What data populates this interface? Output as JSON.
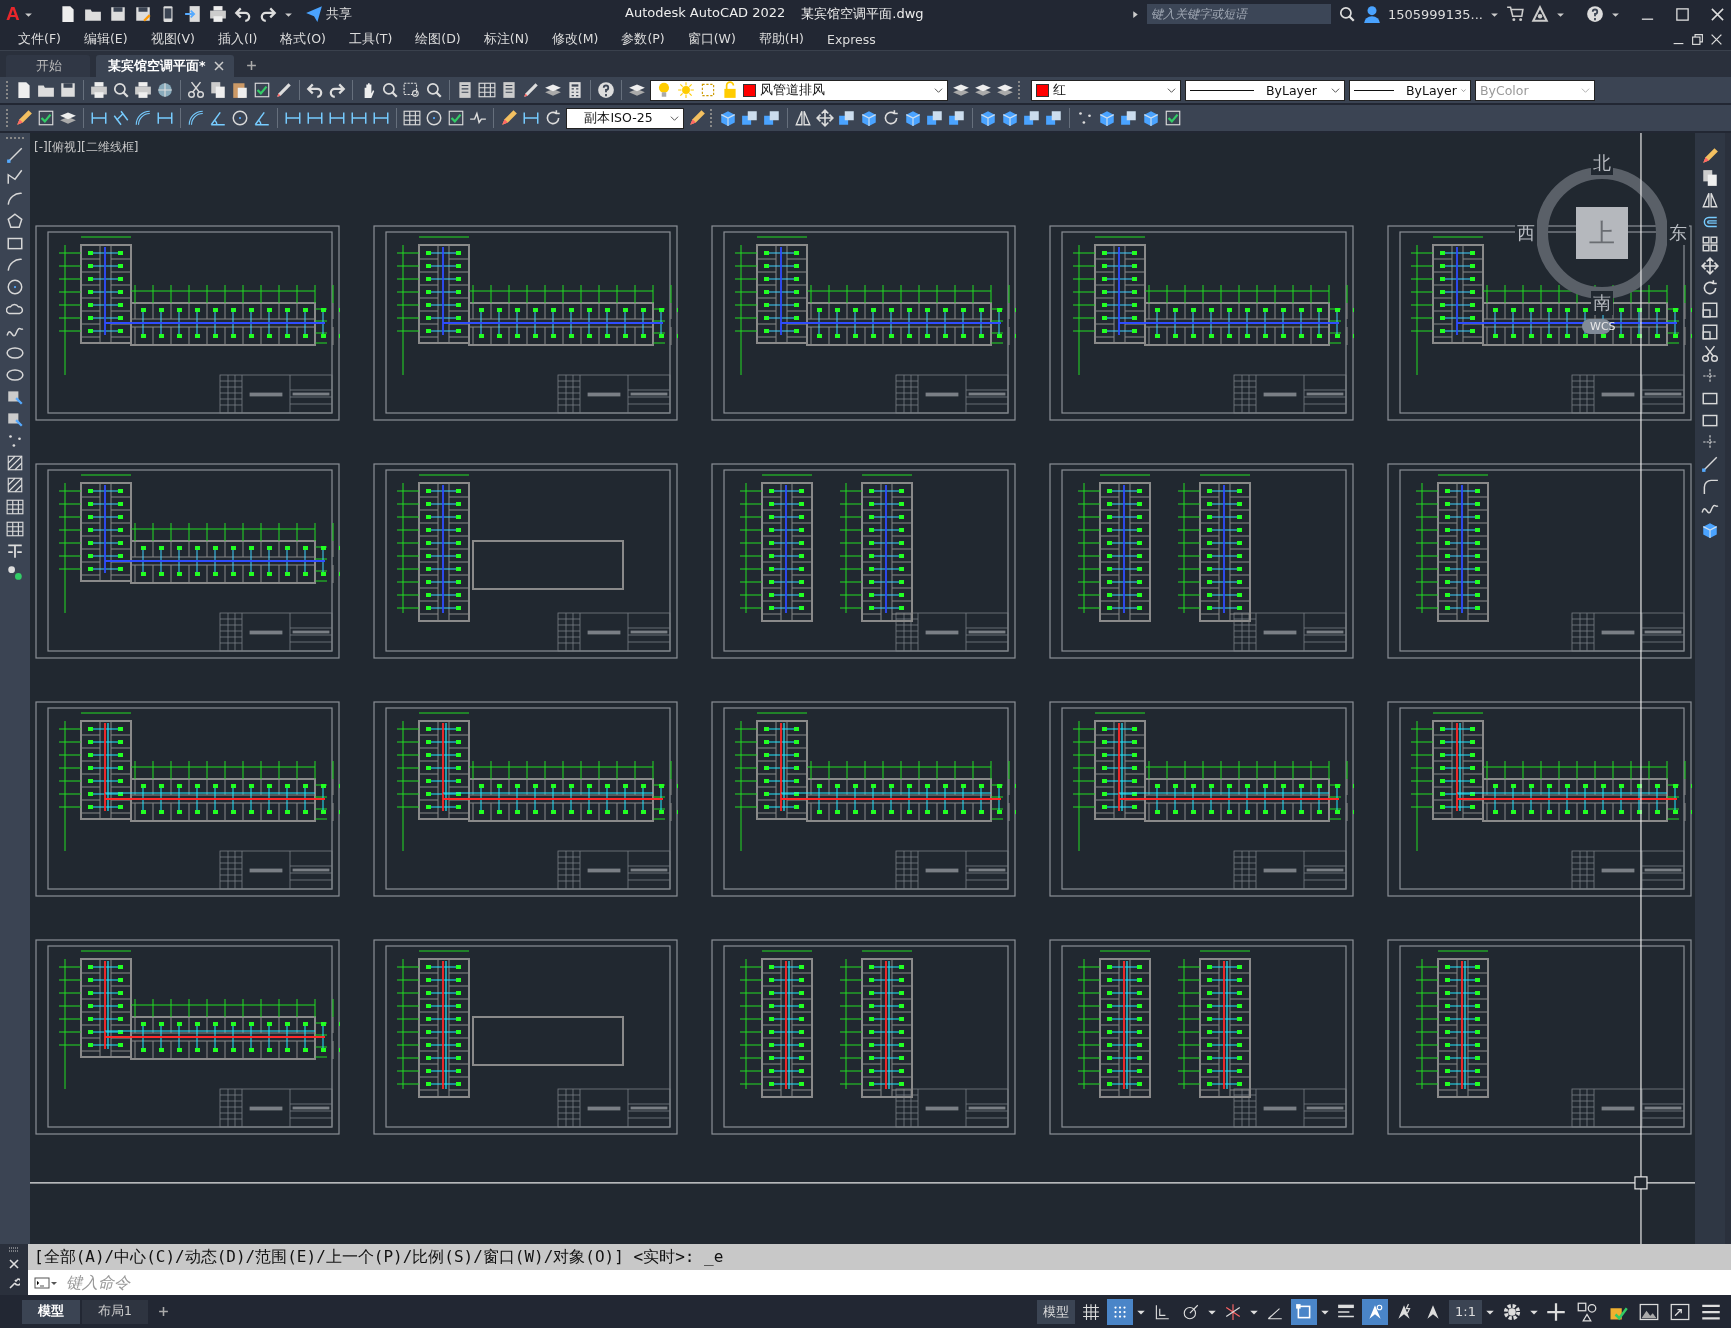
{
  "title_bar": {
    "logo": "A",
    "share": "共享",
    "app_title": "Autodesk AutoCAD 2022",
    "file_name": "某宾馆空调平面.dwg",
    "search": {
      "placeholder": "键入关键字或短语"
    },
    "user": "1505999135..."
  },
  "menu": [
    "文件(F)",
    "编辑(E)",
    "视图(V)",
    "插入(I)",
    "格式(O)",
    "工具(T)",
    "绘图(D)",
    "标注(N)",
    "修改(M)",
    "参数(P)",
    "窗口(W)",
    "帮助(H)",
    "Express"
  ],
  "doc_tabs": [
    {
      "label": "开始",
      "selected": false
    },
    {
      "label": "某宾馆空调平面*",
      "selected": true
    }
  ],
  "properties": {
    "layer": "风管道排风",
    "color_name": "红",
    "linetype": "ByLayer",
    "lineweight": "ByLayer",
    "plot_style": "ByColor",
    "dim_style": "副本ISO-25"
  },
  "viewport_label": "[-][俯视][二维线框]",
  "viewcube": {
    "north": "北",
    "south": "南",
    "west": "西",
    "east": "东",
    "top": "上",
    "ucs": "WCS"
  },
  "sheets": [
    {
      "kind": "full",
      "supply": false
    },
    {
      "kind": "full",
      "supply": false
    },
    {
      "kind": "full",
      "supply": false
    },
    {
      "kind": "full",
      "supply": false
    },
    {
      "kind": "full",
      "supply": false
    },
    {
      "kind": "full",
      "supply": false
    },
    {
      "kind": "wing-outline",
      "supply": false
    },
    {
      "kind": "two-wings",
      "supply": false
    },
    {
      "kind": "two-wings",
      "supply": false
    },
    {
      "kind": "one-wing",
      "supply": false
    },
    {
      "kind": "full",
      "supply": true
    },
    {
      "kind": "full",
      "supply": true
    },
    {
      "kind": "full",
      "supply": true
    },
    {
      "kind": "full",
      "supply": true
    },
    {
      "kind": "full",
      "supply": true
    },
    {
      "kind": "full",
      "supply": true
    },
    {
      "kind": "wing-outline",
      "supply": true
    },
    {
      "kind": "two-wings",
      "supply": true
    },
    {
      "kind": "two-wings",
      "supply": true
    },
    {
      "kind": "one-wing",
      "supply": true
    }
  ],
  "command": {
    "history": "[全部(A)/中心(C)/动态(D)/范围(E)/上一个(P)/比例(S)/窗口(W)/对象(O)] <实时>: _e",
    "placeholder": "键入命令"
  },
  "layout_tabs": [
    {
      "label": "模型",
      "selected": true
    },
    {
      "label": "布局1",
      "selected": false
    }
  ],
  "status": {
    "space": "模型",
    "scale": "1:1"
  },
  "status_toggles": [
    {
      "kind": "grid",
      "on": false
    },
    {
      "kind": "snap",
      "on": true
    },
    {
      "kind": "ortho",
      "on": false
    },
    {
      "kind": "polar",
      "on": false
    },
    {
      "kind": "isodraft",
      "on": false
    },
    {
      "kind": "tracking",
      "on": false
    },
    {
      "kind": "osnap",
      "on": true
    },
    {
      "kind": "lineweight",
      "on": false
    },
    {
      "kind": "annovis",
      "on": true
    },
    {
      "kind": "autoscale",
      "on": false
    },
    {
      "kind": "annoscale",
      "on": false
    }
  ]
}
